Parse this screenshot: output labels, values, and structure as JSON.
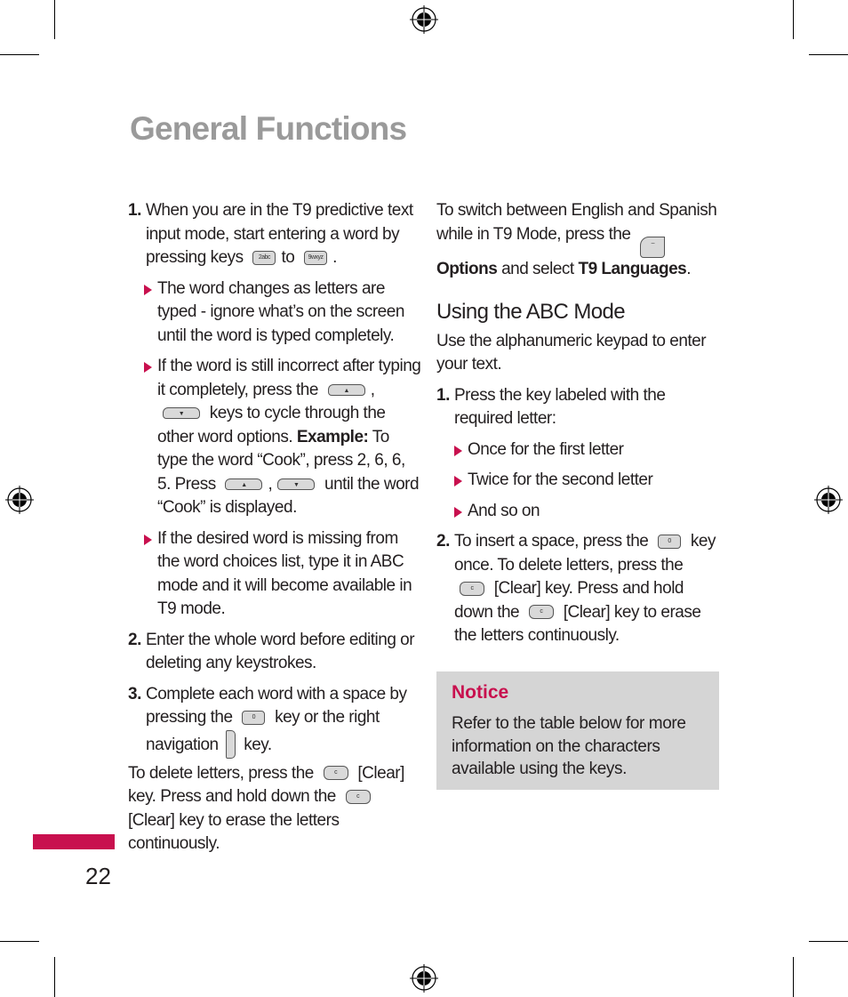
{
  "page": {
    "title": "General Functions",
    "page_number": "22",
    "accent_color": "#c8104e"
  },
  "left_column": {
    "item1": {
      "number": "1.",
      "text_before_keys": "When you are in the T9 predictive text input mode, start entering a word by pressing keys",
      "key_from": "2abc",
      "text_between_keys": "to",
      "key_to": "9wxyz",
      "text_after_keys": "."
    },
    "bullets": [
      {
        "text": "The word changes as letters are typed - ignore what’s on the screen until the word is typed completely."
      },
      {
        "text_before": "If the word is still incorrect after typing it completely, press the",
        "key_up": "▲",
        "key_down": "▼",
        "text_after": "keys to cycle through the other word options.",
        "example_label": "Example:",
        "example_text": "To type the word “Cook”, press 2, 6, 6, 5. Press",
        "example_after": "until the word “Cook” is displayed."
      },
      {
        "text": "If the desired word is missing from the word choices list, type it in ABC mode and it will become available in T9 mode."
      }
    ],
    "item2": {
      "number": "2.",
      "text": "Enter the whole word before editing or deleting any keystrokes."
    },
    "item3": {
      "number": "3.",
      "text_before": "Complete each word with a space by pressing the",
      "key_space": "0",
      "text_middle": "key or the right navigation",
      "text_after": "key."
    },
    "delete_para": {
      "text_before": "To delete letters, press the",
      "key_clear": "c",
      "text_middle": "[Clear] key. Press and hold down the",
      "text_after": "[Clear] key to erase the letters continuously."
    }
  },
  "right_column": {
    "switch_para": {
      "text_before": "To switch between English and Spanish while in T9 Mode, press the",
      "options_label": "Options",
      "text_middle": "and select",
      "menu_label": "T9 Languages",
      "text_after": "."
    },
    "heading": "Using the ABC Mode",
    "intro": "Use the alphanumeric keypad to enter your text.",
    "item1": {
      "number": "1.",
      "text": "Press the key labeled with the required letter:"
    },
    "bullets": [
      {
        "text": "Once for the first letter"
      },
      {
        "text": "Twice for the second letter"
      },
      {
        "text": "And so on"
      }
    ],
    "item2": {
      "number": "2.",
      "text_before": "To insert a space, press the",
      "text_a": "key once. To delete letters, press the",
      "text_b": "[Clear] key. Press and hold down the",
      "text_c": "[Clear] key to erase the letters continuously."
    },
    "notice": {
      "title": "Notice",
      "body": "Refer to the table below for more information on the characters available using the keys."
    }
  }
}
